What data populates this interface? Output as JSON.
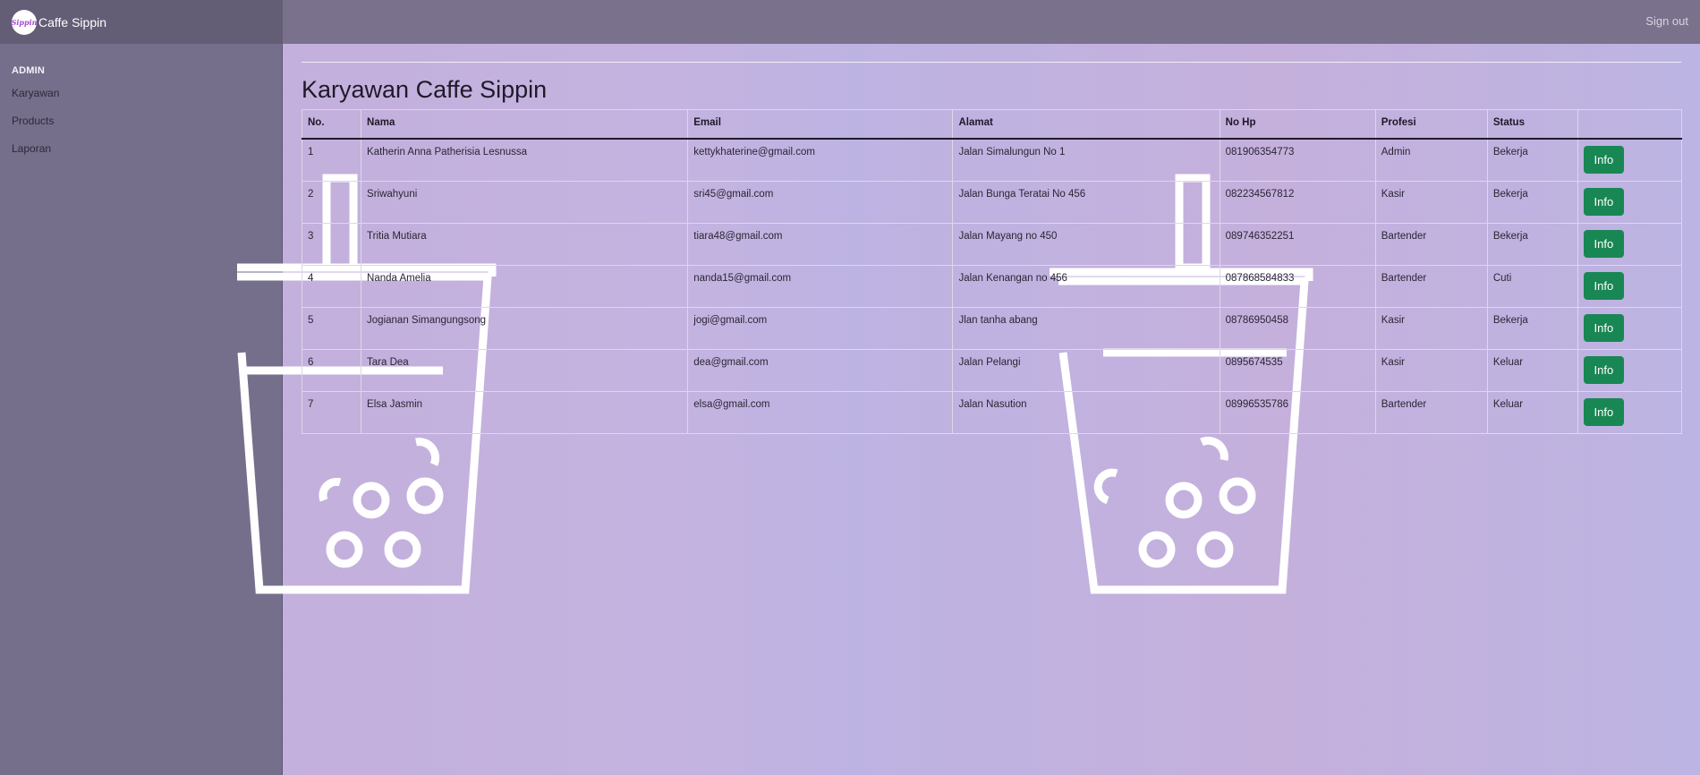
{
  "brand": {
    "name": "Caffe Sippin",
    "logo_text": "Sippin"
  },
  "topbar": {
    "signout": "Sign out"
  },
  "sidebar": {
    "heading": "ADMIN",
    "items": [
      {
        "label": "Karyawan"
      },
      {
        "label": "Products"
      },
      {
        "label": "Laporan"
      }
    ]
  },
  "page": {
    "title": "Karyawan Caffe Sippin"
  },
  "table": {
    "headers": [
      "No.",
      "Nama",
      "Email",
      "Alamat",
      "No Hp",
      "Profesi",
      "Status",
      ""
    ],
    "button_label": "Info",
    "rows": [
      {
        "no": "1",
        "nama": "Katherin Anna Patherisia Lesnussa",
        "email": "kettykhaterine@gmail.com",
        "alamat": "Jalan Simalungun No 1",
        "hp": "081906354773",
        "profesi": "Admin",
        "status": "Bekerja"
      },
      {
        "no": "2",
        "nama": "Sriwahyuni",
        "email": "sri45@gmail.com",
        "alamat": "Jalan Bunga Teratai No 456",
        "hp": "082234567812",
        "profesi": "Kasir",
        "status": "Bekerja"
      },
      {
        "no": "3",
        "nama": "Tritia Mutiara",
        "email": "tiara48@gmail.com",
        "alamat": "Jalan Mayang no 450",
        "hp": "089746352251",
        "profesi": "Bartender",
        "status": "Bekerja"
      },
      {
        "no": "4",
        "nama": "Nanda Amelia",
        "email": "nanda15@gmail.com",
        "alamat": "Jalan Kenangan no 456",
        "hp": "087868584833",
        "profesi": "Bartender",
        "status": "Cuti"
      },
      {
        "no": "5",
        "nama": "Jogianan Simangungsong",
        "email": "jogi@gmail.com",
        "alamat": "Jlan tanha abang",
        "hp": "08786950458",
        "profesi": "Kasir",
        "status": "Bekerja"
      },
      {
        "no": "6",
        "nama": "Tara Dea",
        "email": "dea@gmail.com",
        "alamat": "Jalan Pelangi",
        "hp": "0895674535",
        "profesi": "Kasir",
        "status": "Keluar"
      },
      {
        "no": "7",
        "nama": "Elsa Jasmin",
        "email": "elsa@gmail.com",
        "alamat": "Jalan Nasution",
        "hp": "08996535786",
        "profesi": "Bartender",
        "status": "Keluar"
      }
    ]
  },
  "colors": {
    "accent_button": "#198754",
    "sidebar": "#766f8b",
    "topbar": "#7a728c"
  }
}
